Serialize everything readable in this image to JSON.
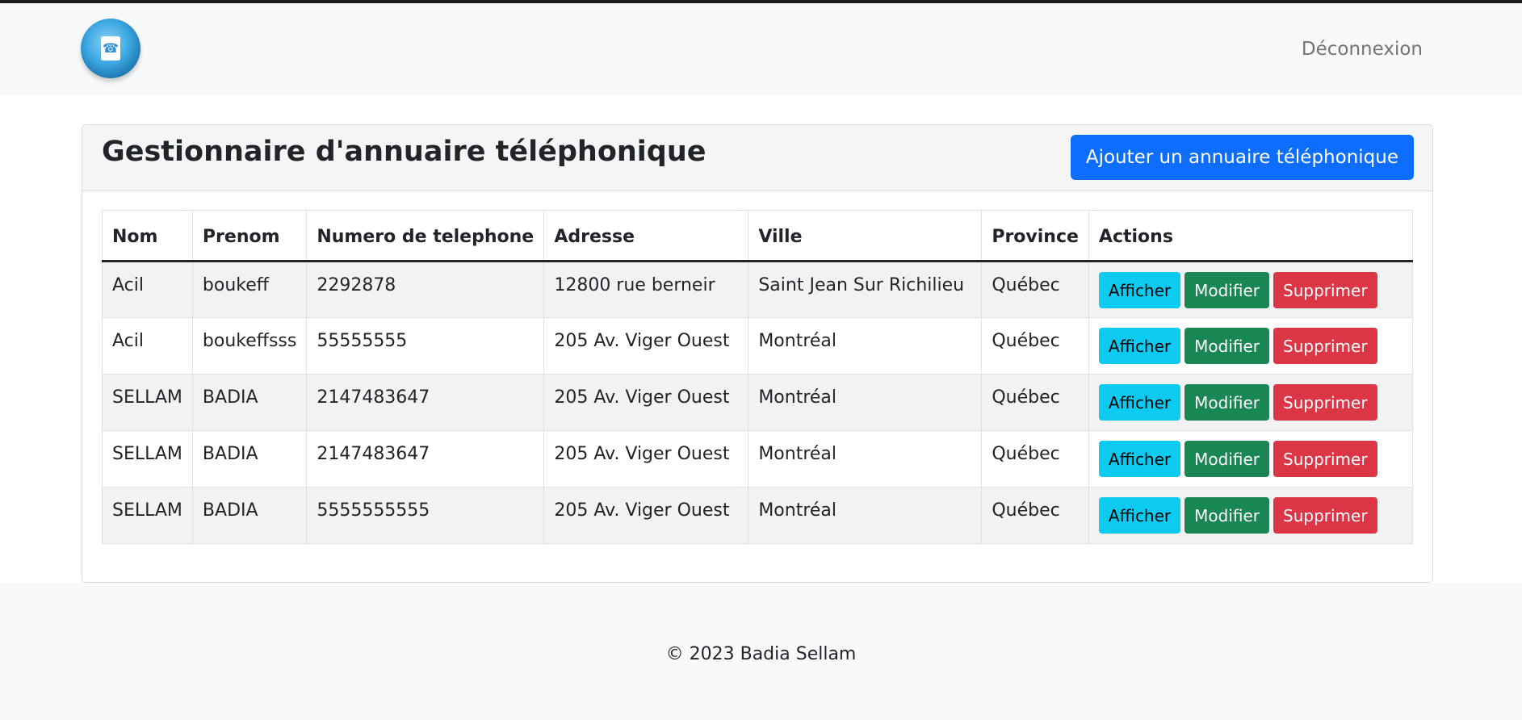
{
  "navbar": {
    "logo_icon": "phonebook-icon",
    "logout_label": "Déconnexion"
  },
  "header": {
    "title": "Gestionnaire d'annuaire téléphonique",
    "add_label": "Ajouter un annuaire téléphonique"
  },
  "table": {
    "columns": [
      "Nom",
      "Prenom",
      "Numero de telephone",
      "Adresse",
      "Ville",
      "Province",
      "Actions"
    ],
    "rows": [
      {
        "nom": "Acil",
        "prenom": "boukeff",
        "tel": "2292878",
        "adresse": "12800 rue berneir",
        "ville": "Saint Jean Sur Richilieu",
        "province": "Québec"
      },
      {
        "nom": "Acil",
        "prenom": "boukeffsss",
        "tel": "55555555",
        "adresse": "205 Av. Viger Ouest",
        "ville": "Montréal",
        "province": "Québec"
      },
      {
        "nom": "SELLAM",
        "prenom": "BADIA",
        "tel": "2147483647",
        "adresse": "205 Av. Viger Ouest",
        "ville": "Montréal",
        "province": "Québec"
      },
      {
        "nom": "SELLAM",
        "prenom": "BADIA",
        "tel": "2147483647",
        "adresse": "205 Av. Viger Ouest",
        "ville": "Montréal",
        "province": "Québec"
      },
      {
        "nom": "SELLAM",
        "prenom": "BADIA",
        "tel": "5555555555",
        "adresse": "205 Av. Viger Ouest",
        "ville": "Montréal",
        "province": "Québec"
      }
    ],
    "actions": {
      "show": "Afficher",
      "edit": "Modifier",
      "delete": "Supprimer"
    }
  },
  "footer": {
    "text": "© 2023 Badia Sellam"
  },
  "colors": {
    "primary": "#0d6efd",
    "info": "#0dcaf0",
    "success": "#198754",
    "danger": "#dc3545"
  }
}
